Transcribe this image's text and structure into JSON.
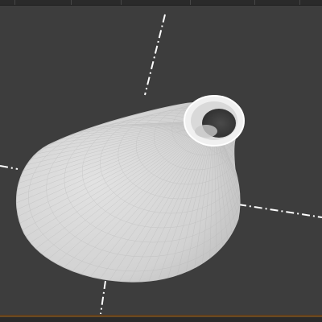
{
  "viewport": {
    "object_name": "cone-mesh",
    "background_color": "#3d3d3d",
    "mesh_color": "#d6d6d6",
    "wire_color": "#bdbdbd",
    "axis_color": "#ffffff"
  }
}
